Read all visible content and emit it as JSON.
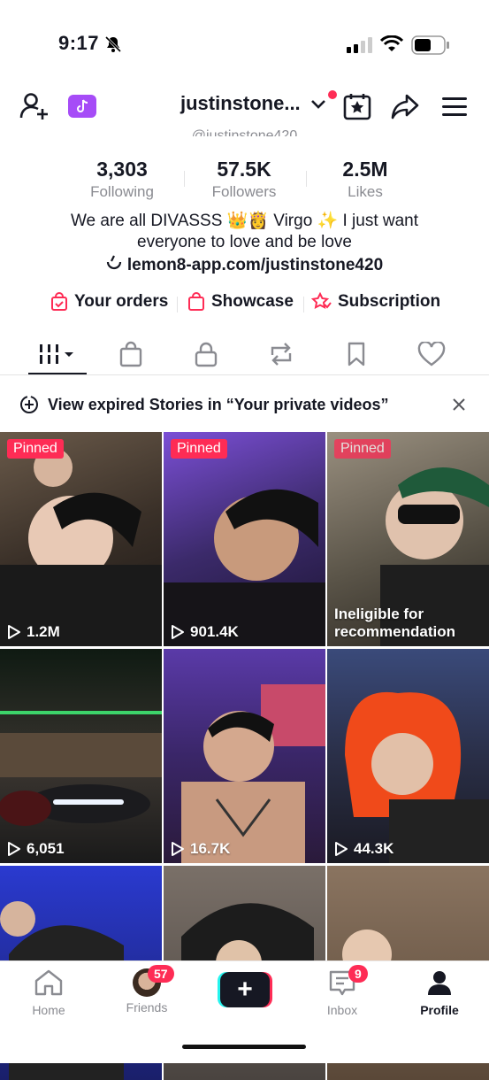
{
  "status_bar": {
    "time": "9:17"
  },
  "header": {
    "username": "justinstone...",
    "handle": "@justinstone420"
  },
  "stats": [
    {
      "value": "3,303",
      "label": "Following"
    },
    {
      "value": "57.5K",
      "label": "Followers"
    },
    {
      "value": "2.5M",
      "label": "Likes"
    }
  ],
  "bio": {
    "text": "We are all DIVASSS 👑👸 Virgo ✨ I just want everyone to love and be love",
    "link": "lemon8-app.com/justinstone420"
  },
  "quick_links": [
    "Your orders",
    "Showcase",
    "Subscription"
  ],
  "tabs": [
    "videos",
    "shop",
    "private",
    "reposts",
    "favorites",
    "liked"
  ],
  "banner": {
    "text": "View expired Stories in “Your private videos”"
  },
  "videos": [
    {
      "badge": "Pinned",
      "views": "1.2M"
    },
    {
      "badge": "Pinned",
      "views": "901.4K"
    },
    {
      "badge": "Pinned",
      "status": "Ineligible for recommendation"
    },
    {
      "views": "6,051"
    },
    {
      "views": "16.7K"
    },
    {
      "views": "44.3K"
    },
    {},
    {},
    {}
  ],
  "bottom_nav": {
    "items": [
      "Home",
      "Friends",
      "",
      "Inbox",
      "Profile"
    ],
    "friends_badge": "57",
    "inbox_badge": "9",
    "create_symbol": "+"
  },
  "colors": {
    "accent": "#fe2c55",
    "text": "#161823",
    "muted": "#8a8b91"
  }
}
